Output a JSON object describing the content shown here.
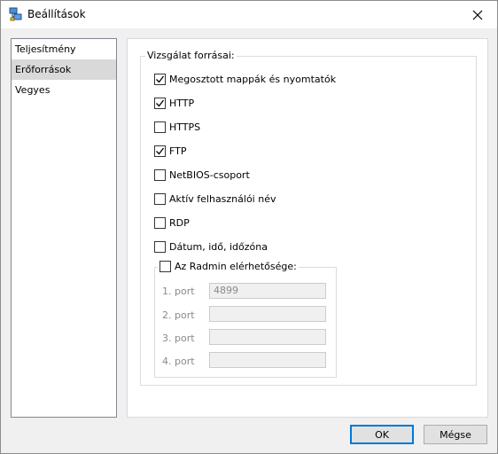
{
  "window": {
    "title": "Beállítások"
  },
  "nav": {
    "items": [
      {
        "label": "Teljesítmény",
        "selected": false
      },
      {
        "label": "Erőforrások",
        "selected": true
      },
      {
        "label": "Vegyes",
        "selected": false
      }
    ]
  },
  "scan": {
    "legend": "Vizsgálat forrásai:",
    "options": [
      {
        "label": "Megosztott mappák és nyomtatók",
        "checked": true
      },
      {
        "label": "HTTP",
        "checked": true
      },
      {
        "label": "HTTPS",
        "checked": false
      },
      {
        "label": "FTP",
        "checked": true
      },
      {
        "label": "NetBIOS-csoport",
        "checked": false
      },
      {
        "label": "Aktív felhasználói név",
        "checked": false
      },
      {
        "label": "RDP",
        "checked": false
      },
      {
        "label": "Dátum, idő, időzóna",
        "checked": false
      }
    ]
  },
  "radmin": {
    "label": "Az Radmin elérhetősége:",
    "checked": false,
    "ports": [
      {
        "label": "1. port",
        "value": "4899"
      },
      {
        "label": "2. port",
        "value": ""
      },
      {
        "label": "3. port",
        "value": ""
      },
      {
        "label": "4. port",
        "value": ""
      }
    ]
  },
  "buttons": {
    "ok": "OK",
    "cancel": "Mégse"
  },
  "colors": {
    "accent": "#0078d7",
    "selection": "#d9d9d9"
  }
}
